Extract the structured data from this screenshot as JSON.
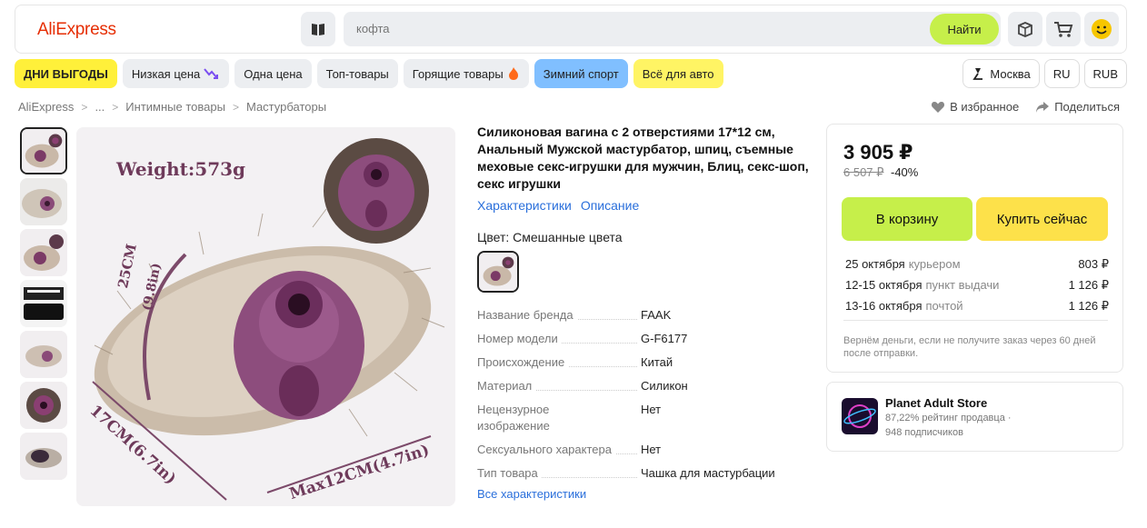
{
  "header": {
    "logo": "AliExpress",
    "search_placeholder": "кофта",
    "search_button": "Найти"
  },
  "nav": {
    "chips": [
      "ДНИ ВЫГОДЫ",
      "Низкая цена",
      "Одна цена",
      "Топ-товары",
      "Горящие товары",
      "Зимний спорт",
      "Всё для авто"
    ],
    "location": "Москва",
    "language": "RU",
    "currency": "RUB"
  },
  "breadcrumb": [
    "AliExpress",
    "...",
    "Интимные товары",
    "Мастурбаторы"
  ],
  "actions": {
    "favorite": "В избранное",
    "share": "Поделиться"
  },
  "product": {
    "title": "Силиконовая вагина с 2 отверстиями 17*12 см, Анальный Мужской мастурбатор, шпиц, съемные меховые секс-игрушки для мужчин, Блиц, секс-шоп, секс игрушки",
    "tabs": [
      "Характеристики",
      "Описание"
    ],
    "color_label": "Цвет: Смешанные цвета",
    "image_labels": {
      "weight": "Weight:573g",
      "height": "25CM",
      "height_in": "(9.8in)",
      "length": "17CM(6.7in)",
      "width": "Max12CM(4.7in)"
    },
    "specs": [
      {
        "key": "Название бренда",
        "value": "FAAK"
      },
      {
        "key": "Номер модели",
        "value": "G-F6177"
      },
      {
        "key": "Происхождение",
        "value": "Китай"
      },
      {
        "key": "Материал",
        "value": "Силикон"
      },
      {
        "key": "Нецензурное изображение",
        "value": "Нет"
      },
      {
        "key": "Сексуального характера",
        "value": "Нет"
      },
      {
        "key": "Тип товара",
        "value": "Чашка для мастурбации"
      }
    ],
    "all_specs_link": "Все характеристики"
  },
  "buybox": {
    "price": "3 905 ₽",
    "old_price": "6 507 ₽",
    "discount": "-40%",
    "add_to_cart": "В корзину",
    "buy_now": "Купить сейчас",
    "delivery": [
      {
        "when": "25 октября",
        "how": "курьером",
        "price": "803 ₽"
      },
      {
        "when": "12-15 октября",
        "how": "пункт выдачи",
        "price": "1 126 ₽"
      },
      {
        "when": "13-16 октября",
        "how": "почтой",
        "price": "1 126 ₽"
      }
    ],
    "refund_note": "Вернём деньги, если не получите заказ через 60 дней после отправки."
  },
  "store": {
    "name": "Planet Adult Store",
    "rating": "87,22% рейтинг продавца",
    "subscribers": "948 подписчиков"
  },
  "colors": {
    "accent_green": "#c6ef4a",
    "accent_yellow": "#fde14a",
    "link_blue": "#2a6fdb",
    "logo_red": "#e62e04"
  }
}
